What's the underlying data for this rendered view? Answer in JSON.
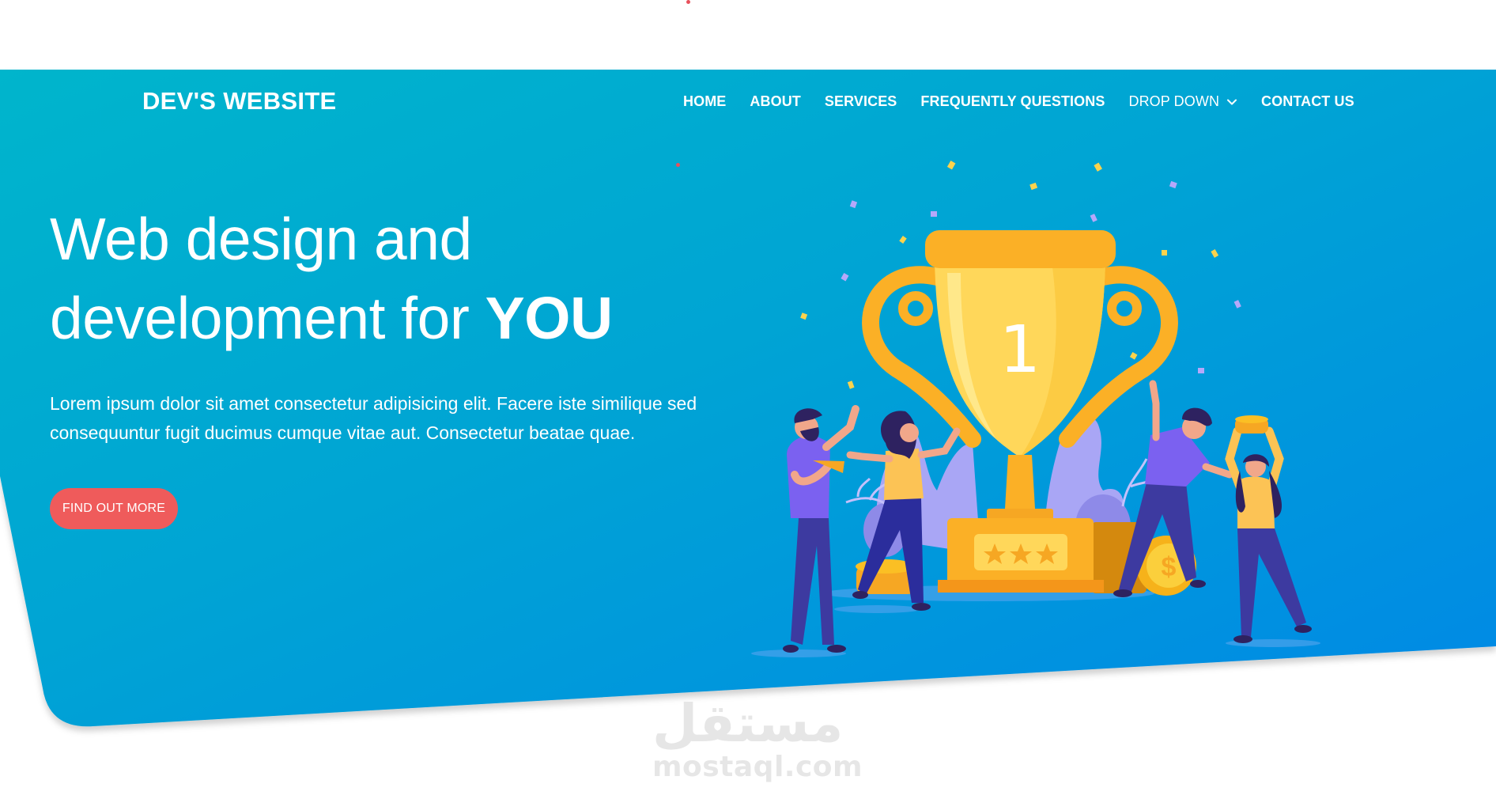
{
  "brand": {
    "name": "DEV'S WEBSITE"
  },
  "nav": {
    "items": [
      {
        "label": "HOME"
      },
      {
        "label": "ABOUT"
      },
      {
        "label": "SERVICES"
      },
      {
        "label": "FREQUENTLY QUESTIONS"
      },
      {
        "label": "DROP DOWN",
        "icon": "chevron-down-icon"
      },
      {
        "label": "CONTACT US"
      }
    ]
  },
  "hero": {
    "title_line1": "Web design and",
    "title_line2_prefix": "development for ",
    "title_line2_emphasis": "YOU",
    "description": "Lorem ipsum dolor sit amet consectetur adipisicing elit. Facere iste similique sed consequuntur fugit ducimus cumque vitae aut. Consectetur beatae quae.",
    "cta_label": "FIND OUT MORE",
    "illustration": {
      "icon": "trophy-celebration-illustration",
      "trophy_number": "1",
      "stars": 3
    }
  },
  "watermark": {
    "arabic": "مستقل",
    "latin": "mostaql.com"
  },
  "colors": {
    "gradient_start": "#00b4cc",
    "gradient_end": "#008fe2",
    "cta": "#ef5b5b",
    "trophy": "#fbb026",
    "trophy_light": "#ffd75a",
    "shirt_purple": "#7b61f0",
    "shirt_yellow": "#fcc355",
    "pants": "#3d3aa0",
    "plant": "#a9a6f5"
  }
}
